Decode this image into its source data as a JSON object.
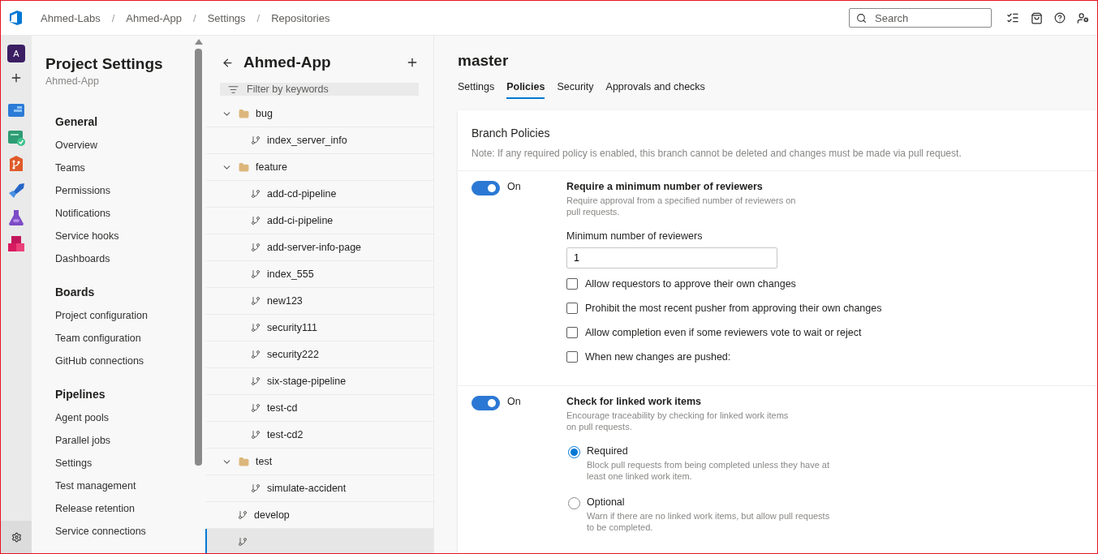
{
  "topbar": {
    "breadcrumb": [
      {
        "kind": "crumb",
        "label": "Ahmed-Labs"
      },
      {
        "kind": "separator",
        "label": "/"
      },
      {
        "kind": "crumb",
        "label": "Ahmed-App"
      },
      {
        "kind": "separator",
        "label": "/"
      },
      {
        "kind": "crumb",
        "label": "Settings"
      },
      {
        "kind": "separator",
        "label": "/"
      },
      {
        "kind": "crumb",
        "label": "Repositories"
      }
    ],
    "search": {
      "placeholder": "Search"
    }
  },
  "rail": {
    "avatar": "A"
  },
  "settings_nav": {
    "title": "Project Settings",
    "subtitle": "Ahmed-App",
    "sections": [
      {
        "heading": "General",
        "items": [
          "Overview",
          "Teams",
          "Permissions",
          "Notifications",
          "Service hooks",
          "Dashboards"
        ]
      },
      {
        "heading": "Boards",
        "items": [
          "Project configuration",
          "Team configuration",
          "GitHub connections"
        ]
      },
      {
        "heading": "Pipelines",
        "items": [
          "Agent pools",
          "Parallel jobs",
          "Settings",
          "Test management",
          "Release retention",
          "Service connections"
        ]
      }
    ]
  },
  "branches": {
    "title": "Ahmed-App",
    "filter": {
      "placeholder": "Filter by keywords"
    },
    "tree": [
      {
        "kind": "folder",
        "label": "bug",
        "expanded": true,
        "children": [
          {
            "kind": "branch",
            "label": "index_server_info",
            "selected": false
          }
        ]
      },
      {
        "kind": "folder",
        "label": "feature",
        "expanded": true,
        "children": [
          {
            "kind": "branch",
            "label": "add-cd-pipeline",
            "selected": false
          },
          {
            "kind": "branch",
            "label": "add-ci-pipeline",
            "selected": false
          },
          {
            "kind": "branch",
            "label": "add-server-info-page",
            "selected": false
          },
          {
            "kind": "branch",
            "label": "index_555",
            "selected": false
          },
          {
            "kind": "branch",
            "label": "new123",
            "selected": false
          },
          {
            "kind": "branch",
            "label": "security111",
            "selected": false
          },
          {
            "kind": "branch",
            "label": "security222",
            "selected": false
          },
          {
            "kind": "branch",
            "label": "six-stage-pipeline",
            "selected": false
          },
          {
            "kind": "branch",
            "label": "test-cd",
            "selected": false
          },
          {
            "kind": "branch",
            "label": "test-cd2",
            "selected": false
          }
        ]
      },
      {
        "kind": "folder",
        "label": "test",
        "expanded": true,
        "children": [
          {
            "kind": "branch",
            "label": "simulate-accident",
            "selected": false
          }
        ]
      },
      {
        "kind": "branch",
        "label": "develop",
        "selected": false
      },
      {
        "kind": "branch",
        "selected": true
      }
    ]
  },
  "detail": {
    "branch": "master",
    "tabs": [
      {
        "label": "Settings",
        "selected": false
      },
      {
        "label": "Policies",
        "selected": true
      },
      {
        "label": "Security",
        "selected": false
      },
      {
        "label": "Approvals and checks",
        "selected": false
      }
    ],
    "card": {
      "title": "Branch Policies",
      "note": "Note: If any required policy is enabled, this branch cannot be deleted and changes must be made via pull request.",
      "policies": [
        {
          "kind": "reviewers",
          "on": true,
          "status": "On",
          "title": "Require a minimum number of reviewers",
          "description": "Require approval from a specified number of reviewers on pull requests.",
          "field": {
            "label": "Minimum number of reviewers",
            "value": "1"
          },
          "options": [
            {
              "label": "Allow requestors to approve their own changes",
              "checked": false
            },
            {
              "label": "Prohibit the most recent pusher from approving their own changes",
              "checked": false
            },
            {
              "label": "Allow completion even if some reviewers vote to wait or reject",
              "checked": false
            },
            {
              "label": "When new changes are pushed:",
              "checked": false
            }
          ]
        },
        {
          "kind": "work_items",
          "on": true,
          "status": "On",
          "title": "Check for linked work items",
          "description": "Encourage traceability by checking for linked work items on pull requests.",
          "choices": [
            {
              "label": "Required",
              "description": "Block pull requests from being completed unless they have at least one linked work item.",
              "selected": true
            },
            {
              "label": "Optional",
              "description": "Warn if there are no linked work items, but allow pull requests to be completed.",
              "selected": false
            }
          ]
        }
      ]
    }
  }
}
